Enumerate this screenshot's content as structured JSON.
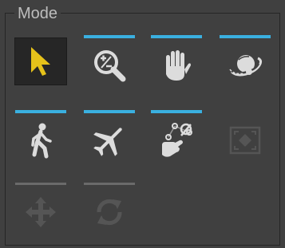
{
  "panel": {
    "title": "Mode"
  },
  "colors": {
    "background": "#404040",
    "accent_bar": "#3ab0e0",
    "inactive_bar": "#6a6a6a",
    "select_arrow": "#e6c21a",
    "icon": "#dcdcdc",
    "disabled_icon": "#555555"
  },
  "modes": [
    {
      "id": "select",
      "icon": "arrow-cursor-icon",
      "selected": true,
      "bar": "none"
    },
    {
      "id": "zoom",
      "icon": "zoom-plus-minus-icon",
      "selected": false,
      "bar": "active"
    },
    {
      "id": "pan",
      "icon": "hand-icon",
      "selected": false,
      "bar": "active"
    },
    {
      "id": "orbit",
      "icon": "orbit-planet-icon",
      "selected": false,
      "bar": "active"
    },
    {
      "id": "walk",
      "icon": "walking-person-icon",
      "selected": false,
      "bar": "active"
    },
    {
      "id": "fly",
      "icon": "airplane-icon",
      "selected": false,
      "bar": "active"
    },
    {
      "id": "measure",
      "icon": "hand-measure-icon",
      "selected": false,
      "bar": "active"
    },
    {
      "id": "fit-view",
      "icon": "fit-frame-icon",
      "selected": false,
      "bar": "none",
      "disabled": true
    },
    {
      "id": "move",
      "icon": "move-arrows-icon",
      "selected": false,
      "bar": "inactive",
      "disabled": true
    },
    {
      "id": "rotate",
      "icon": "rotate-arrows-icon",
      "selected": false,
      "bar": "inactive",
      "disabled": true
    }
  ]
}
